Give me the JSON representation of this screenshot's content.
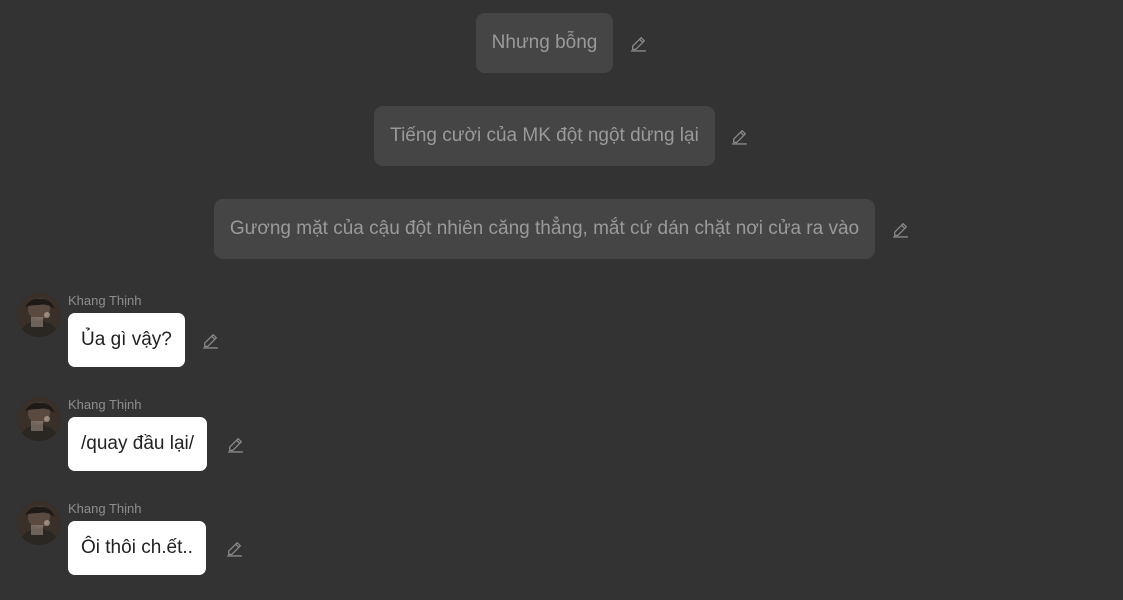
{
  "narrations": [
    {
      "text": "Nhưng bỗng"
    },
    {
      "text": "Tiếng cười của MK đột ngột dừng lại"
    },
    {
      "text": "Gương mặt của cậu đột nhiên căng thẳng, mắt cứ dán chặt nơi cửa ra vào"
    }
  ],
  "messages": [
    {
      "sender": "Khang Thịnh",
      "text": "Ủa gì vậy?"
    },
    {
      "sender": "Khang Thịnh",
      "text": "/quay đầu lại/"
    },
    {
      "sender": "Khang Thịnh",
      "text": "Ôi thôi ch.ết.."
    }
  ],
  "icons": {
    "edit": "pencil-icon",
    "avatar": "character-avatar"
  },
  "colors": {
    "background": "#333333",
    "narration_bubble": "#454545",
    "narration_text": "#9a9a9a",
    "message_bubble": "#ffffff",
    "message_text": "#222222",
    "sender_text": "#8e8e8e"
  }
}
